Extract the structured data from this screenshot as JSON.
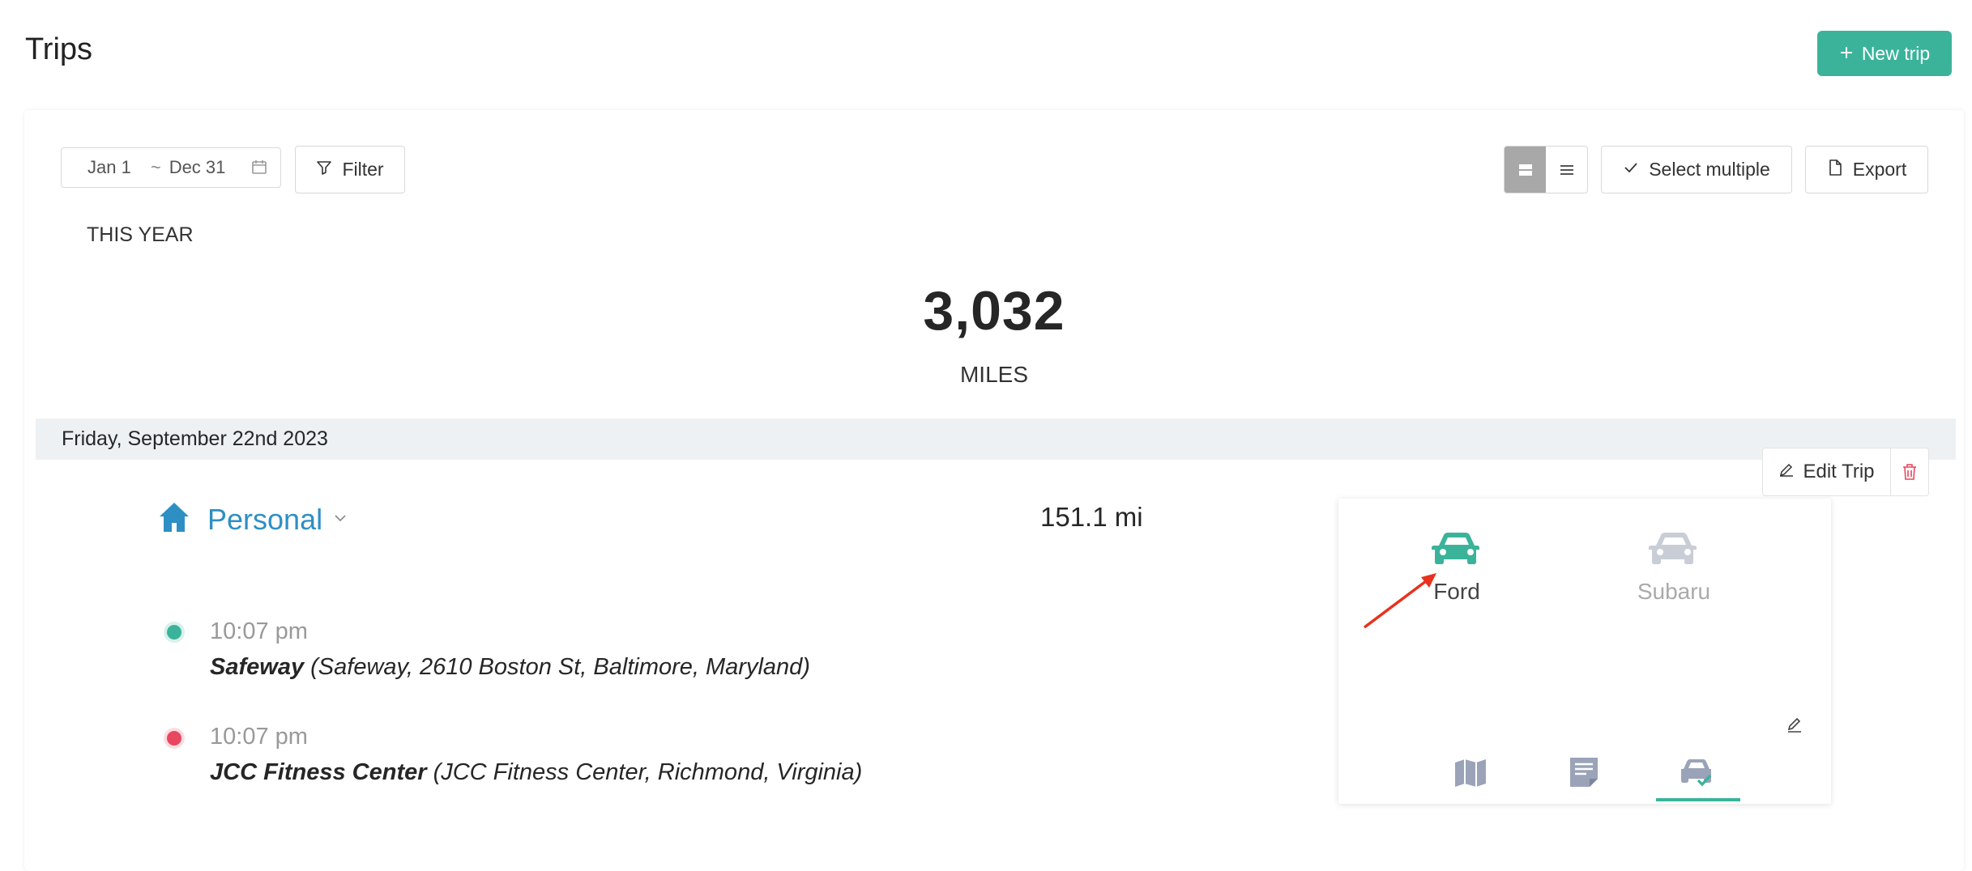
{
  "page": {
    "title": "Trips"
  },
  "header": {
    "new_trip_label": "New trip"
  },
  "toolbar": {
    "date_from": "Jan 1",
    "date_sep": "~",
    "date_to": "Dec 31",
    "filter_label": "Filter",
    "select_multiple_label": "Select multiple",
    "export_label": "Export"
  },
  "summary": {
    "period": "THIS YEAR",
    "total": "3,032",
    "unit": "MILES"
  },
  "day": {
    "header": "Friday, September 22nd 2023",
    "trip": {
      "edit_label": "Edit Trip",
      "purpose": "Personal",
      "distance": "151.1 mi",
      "stops": [
        {
          "time": "10:07 pm",
          "name": "Safeway",
          "address": "(Safeway, 2610 Boston St, Baltimore, Maryland)",
          "color": "#3ab39a"
        },
        {
          "time": "10:07 pm",
          "name": "JCC Fitness Center",
          "address": "(JCC Fitness Center, Richmond, Virginia)",
          "color": "#e8475f"
        }
      ]
    }
  },
  "vehicle_panel": {
    "vehicles": [
      {
        "name": "Ford",
        "selected": true,
        "color": "#3ab39a"
      },
      {
        "name": "Subaru",
        "selected": false,
        "color": "#c9cdd6"
      }
    ],
    "tabs": [
      "map-icon",
      "notes-icon",
      "vehicle-icon"
    ],
    "active_tab": "vehicle-icon"
  },
  "colors": {
    "accent": "#3ab39a",
    "purpose": "#2e8fc4",
    "danger": "#e8475f",
    "annotation": "#e8321e"
  }
}
